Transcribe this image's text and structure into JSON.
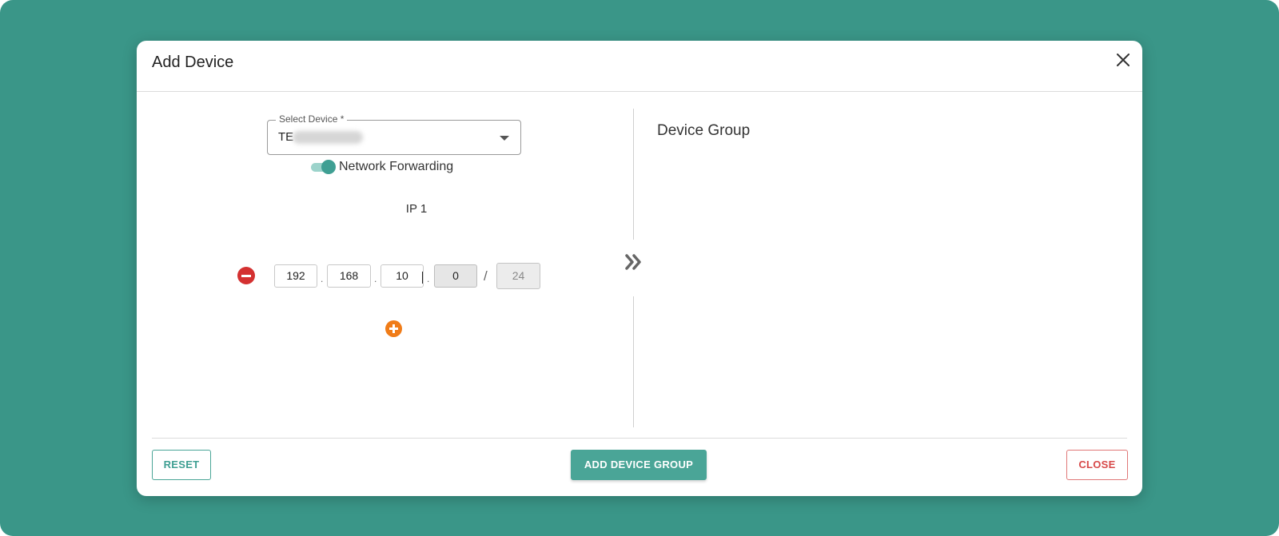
{
  "modal": {
    "title": "Add Device"
  },
  "device_select": {
    "label": "Select Device *",
    "value": "TE"
  },
  "network_forwarding": {
    "label": "Network Forwarding",
    "enabled": true
  },
  "ip_entries": [
    {
      "label": "IP 1",
      "octets": [
        "192",
        "168",
        "10",
        "0"
      ],
      "mask": "24"
    }
  ],
  "device_group": {
    "title": "Device Group"
  },
  "footer": {
    "reset_label": "RESET",
    "add_group_label": "ADD DEVICE GROUP",
    "close_label": "CLOSE"
  },
  "colors": {
    "background": "#3a9688",
    "accent": "#4aa597",
    "danger": "#d43131",
    "add": "#f07c18"
  }
}
